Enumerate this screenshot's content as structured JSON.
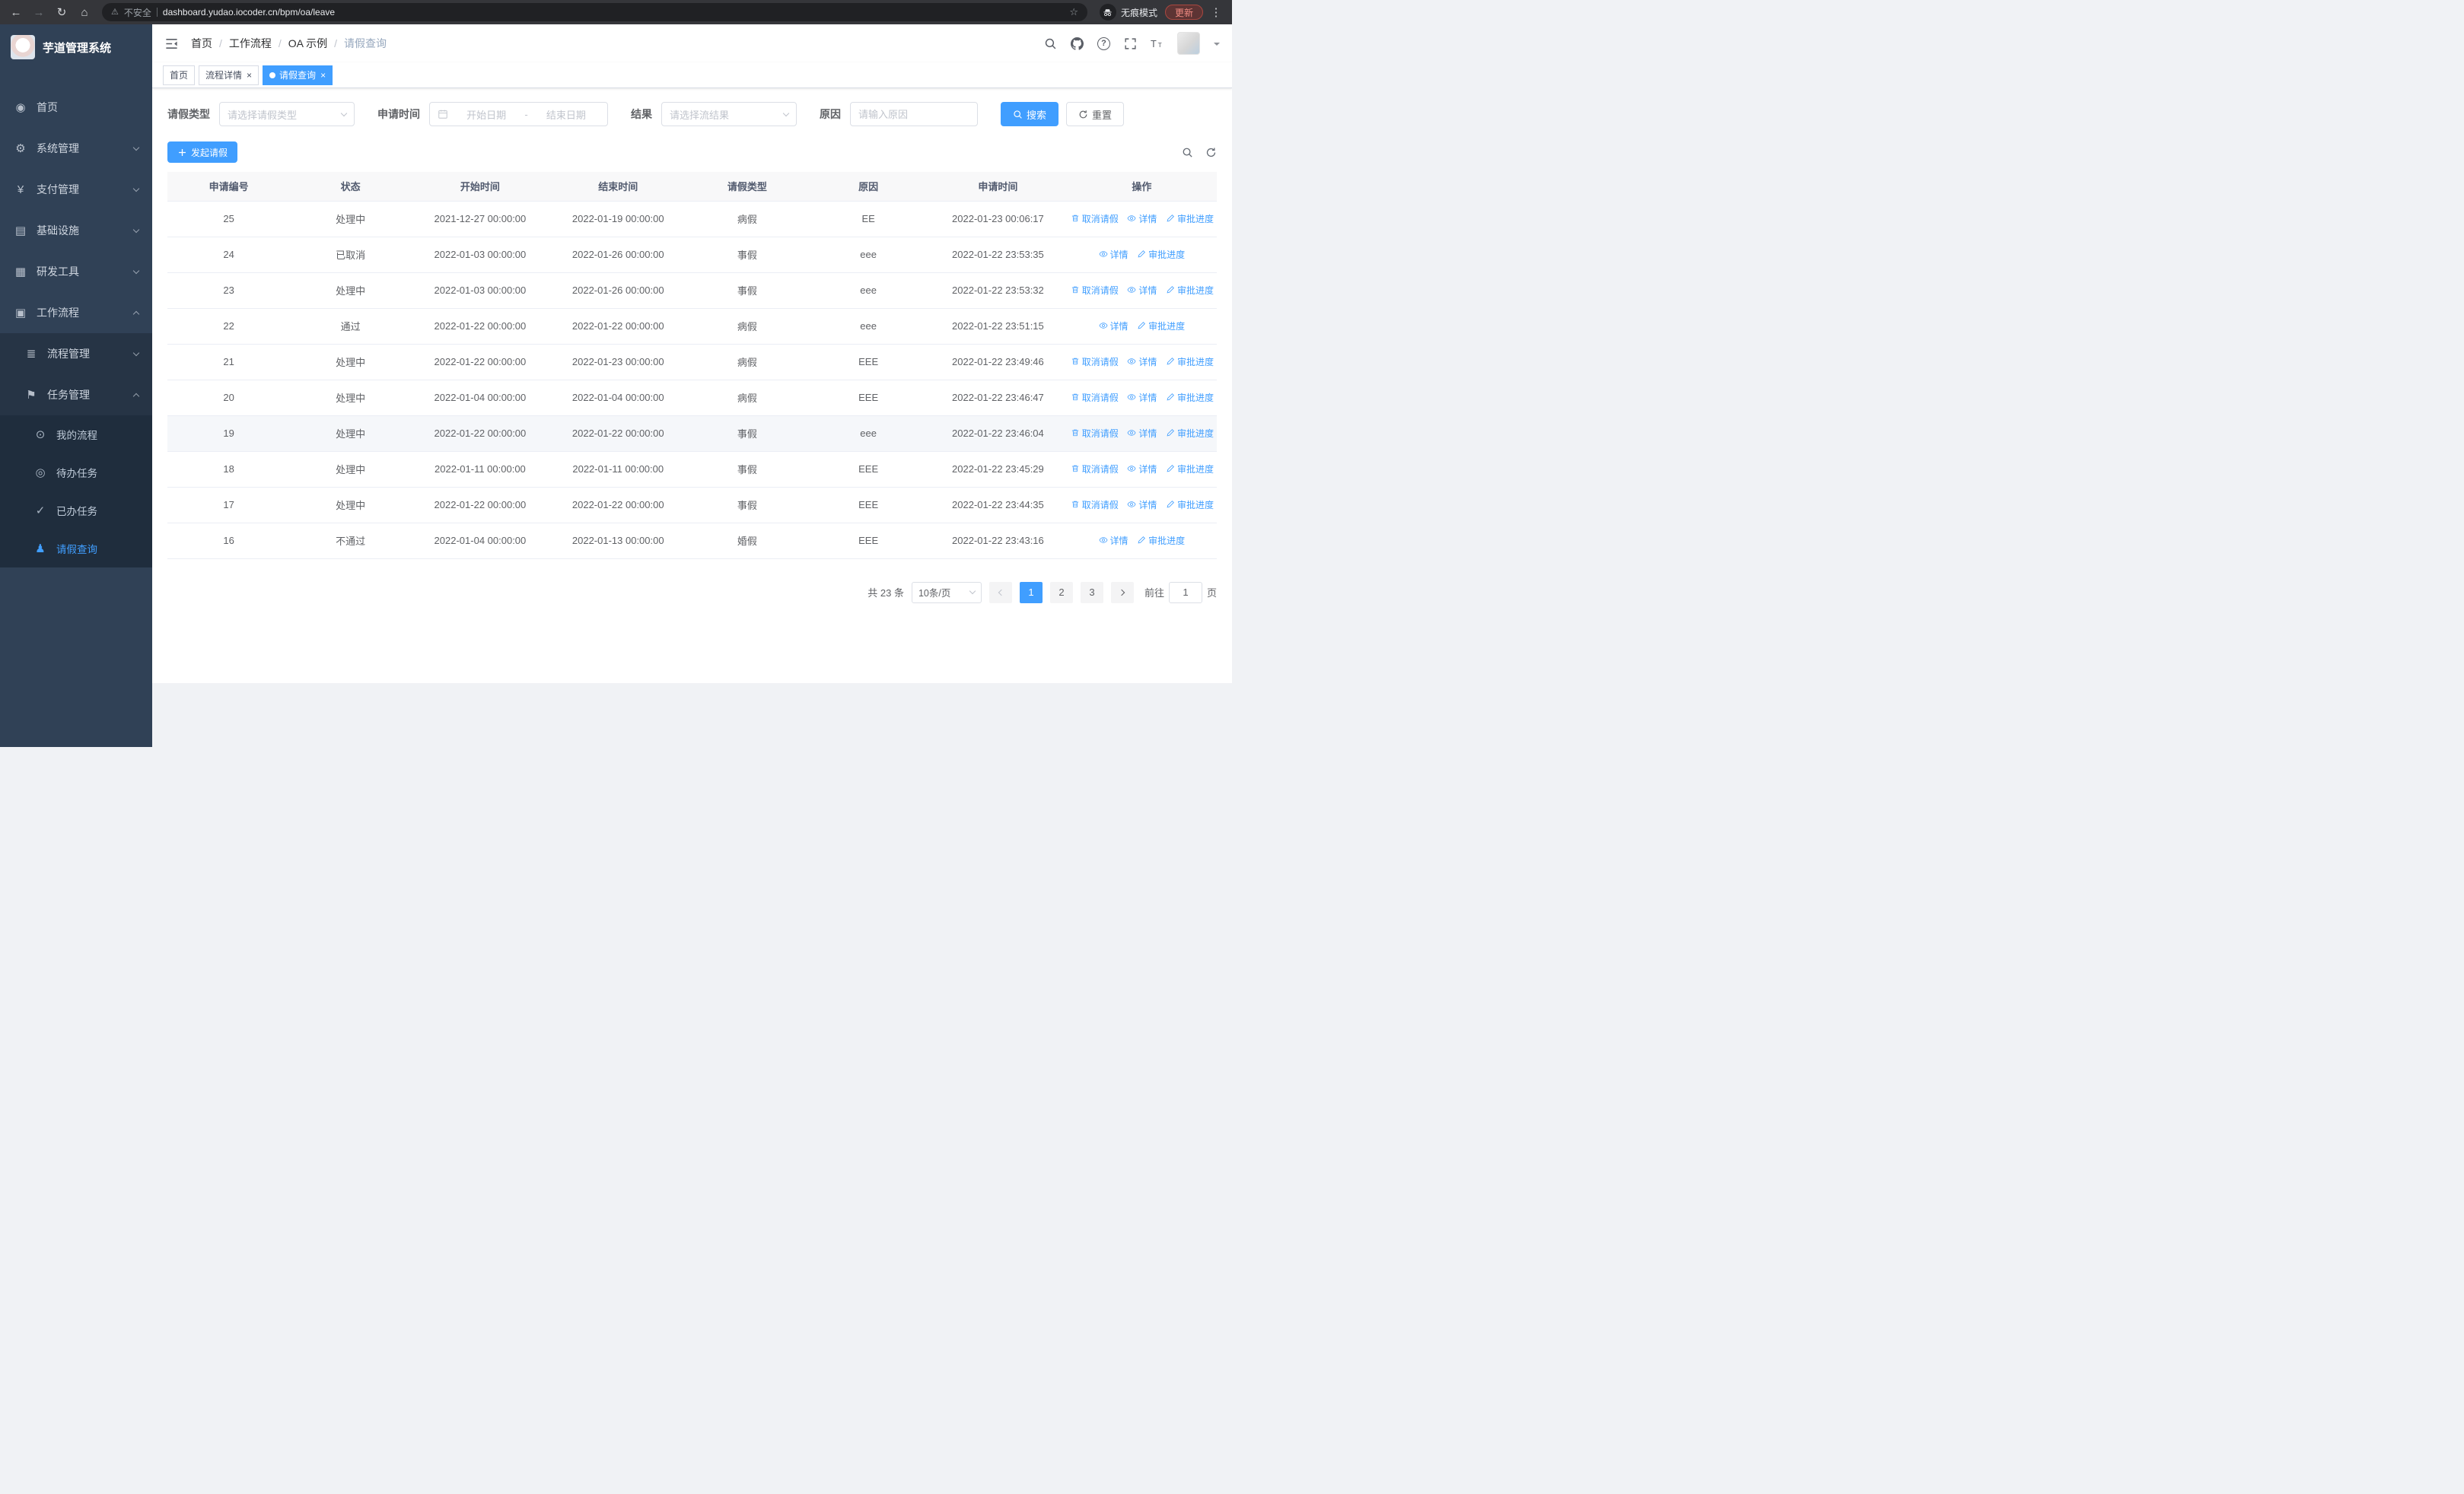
{
  "browser": {
    "security": "不安全",
    "url": "dashboard.yudao.iocoder.cn/bpm/oa/leave",
    "incognito": "无痕模式",
    "update": "更新"
  },
  "sidebar": {
    "title": "芋道管理系统",
    "menu": [
      {
        "label": "首页",
        "icon": "dashboard-icon",
        "level": 1
      },
      {
        "label": "系统管理",
        "icon": "gear-icon",
        "level": 1,
        "expand": "down"
      },
      {
        "label": "支付管理",
        "icon": "yen-icon",
        "level": 1,
        "expand": "down"
      },
      {
        "label": "基础设施",
        "icon": "infrastructure-icon",
        "level": 1,
        "expand": "down"
      },
      {
        "label": "研发工具",
        "icon": "devtools-icon",
        "level": 1,
        "expand": "down"
      },
      {
        "label": "工作流程",
        "icon": "workflow-icon",
        "level": 1,
        "expand": "up"
      },
      {
        "label": "流程管理",
        "icon": "process-icon",
        "level": 2,
        "expand": "down"
      },
      {
        "label": "任务管理",
        "icon": "task-icon",
        "level": 2,
        "expand": "up"
      },
      {
        "label": "我的流程",
        "icon": "my-process-icon",
        "level": 3
      },
      {
        "label": "待办任务",
        "icon": "todo-icon",
        "level": 3
      },
      {
        "label": "已办任务",
        "icon": "done-icon",
        "level": 3
      },
      {
        "label": "请假查询",
        "icon": "user-icon",
        "level": 3,
        "active": true
      }
    ]
  },
  "navbar": {
    "breadcrumb": [
      "首页",
      "工作流程",
      "OA 示例",
      "请假查询"
    ]
  },
  "tabs": [
    {
      "label": "首页",
      "closable": false,
      "active": false
    },
    {
      "label": "流程详情",
      "closable": true,
      "active": false
    },
    {
      "label": "请假查询",
      "closable": true,
      "active": true
    }
  ],
  "filters": {
    "leave_type_label": "请假类型",
    "leave_type_placeholder": "请选择请假类型",
    "apply_time_label": "申请时间",
    "start_date_placeholder": "开始日期",
    "range_separator": "-",
    "end_date_placeholder": "结束日期",
    "result_label": "结果",
    "result_placeholder": "请选择流结果",
    "reason_label": "原因",
    "reason_placeholder": "请输入原因",
    "search_button": "搜索",
    "reset_button": "重置"
  },
  "toolbar": {
    "create_button": "发起请假"
  },
  "table": {
    "headers": [
      "申请编号",
      "状态",
      "开始时间",
      "结束时间",
      "请假类型",
      "原因",
      "申请时间",
      "操作"
    ],
    "actions": {
      "cancel": "取消请假",
      "detail": "详情",
      "progress": "审批进度"
    },
    "rows": [
      {
        "id": "25",
        "status": "处理中",
        "start": "2021-12-27 00:00:00",
        "end": "2022-01-19 00:00:00",
        "type": "病假",
        "reason": "EE",
        "applied": "2022-01-23 00:06:17",
        "cancellable": true
      },
      {
        "id": "24",
        "status": "已取消",
        "start": "2022-01-03 00:00:00",
        "end": "2022-01-26 00:00:00",
        "type": "事假",
        "reason": "eee",
        "applied": "2022-01-22 23:53:35",
        "cancellable": false
      },
      {
        "id": "23",
        "status": "处理中",
        "start": "2022-01-03 00:00:00",
        "end": "2022-01-26 00:00:00",
        "type": "事假",
        "reason": "eee",
        "applied": "2022-01-22 23:53:32",
        "cancellable": true
      },
      {
        "id": "22",
        "status": "通过",
        "start": "2022-01-22 00:00:00",
        "end": "2022-01-22 00:00:00",
        "type": "病假",
        "reason": "eee",
        "applied": "2022-01-22 23:51:15",
        "cancellable": false
      },
      {
        "id": "21",
        "status": "处理中",
        "start": "2022-01-22 00:00:00",
        "end": "2022-01-23 00:00:00",
        "type": "病假",
        "reason": "EEE",
        "applied": "2022-01-22 23:49:46",
        "cancellable": true
      },
      {
        "id": "20",
        "status": "处理中",
        "start": "2022-01-04 00:00:00",
        "end": "2022-01-04 00:00:00",
        "type": "病假",
        "reason": "EEE",
        "applied": "2022-01-22 23:46:47",
        "cancellable": true
      },
      {
        "id": "19",
        "status": "处理中",
        "start": "2022-01-22 00:00:00",
        "end": "2022-01-22 00:00:00",
        "type": "事假",
        "reason": "eee",
        "applied": "2022-01-22 23:46:04",
        "cancellable": true,
        "hover": true
      },
      {
        "id": "18",
        "status": "处理中",
        "start": "2022-01-11 00:00:00",
        "end": "2022-01-11 00:00:00",
        "type": "事假",
        "reason": "EEE",
        "applied": "2022-01-22 23:45:29",
        "cancellable": true
      },
      {
        "id": "17",
        "status": "处理中",
        "start": "2022-01-22 00:00:00",
        "end": "2022-01-22 00:00:00",
        "type": "事假",
        "reason": "EEE",
        "applied": "2022-01-22 23:44:35",
        "cancellable": true
      },
      {
        "id": "16",
        "status": "不通过",
        "start": "2022-01-04 00:00:00",
        "end": "2022-01-13 00:00:00",
        "type": "婚假",
        "reason": "EEE",
        "applied": "2022-01-22 23:43:16",
        "cancellable": false
      }
    ]
  },
  "pagination": {
    "total": "共 23 条",
    "page_size": "10条/页",
    "pages": [
      "1",
      "2",
      "3"
    ],
    "active_page": "1",
    "goto_label": "前往",
    "goto_value": "1",
    "page_unit": "页"
  },
  "colors": {
    "primary": "#409EFF",
    "sidebar_bg": "#304156",
    "sidebar_submenu_bg": "#263445",
    "sidebar_nested_bg": "#1f2d3d"
  }
}
